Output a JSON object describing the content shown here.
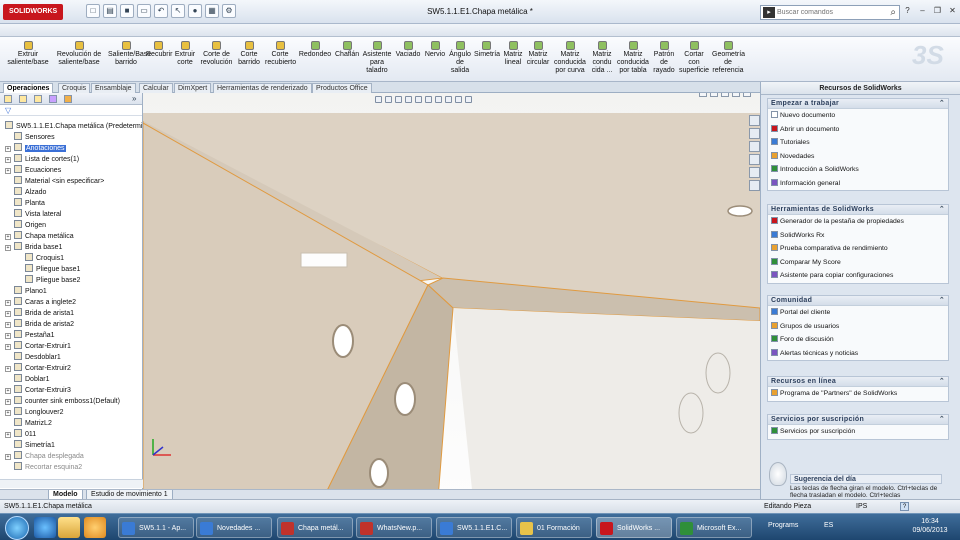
{
  "app": {
    "logo": "SOLIDWORKS",
    "document_title": "SW5.1.1.E1.Chapa metálica *"
  },
  "search": {
    "placeholder": "Buscar comandos"
  },
  "command_manager": {
    "buttons": [
      {
        "label": "Extruir saliente/base"
      },
      {
        "label": "Revolución de saliente/base"
      },
      {
        "label": "Saliente/Base barrido"
      },
      {
        "label": "Recubrir"
      },
      {
        "label": "Extruir corte"
      },
      {
        "label": "Corte de revolución"
      },
      {
        "label": "Corte barrido"
      },
      {
        "label": "Corte recubierto"
      },
      {
        "label": "Redondeo"
      },
      {
        "label": "Chaflán"
      },
      {
        "label": "Asistente para taladro"
      },
      {
        "label": "Vaciado"
      },
      {
        "label": "Nervio"
      },
      {
        "label": "Ángulo de salida"
      },
      {
        "label": "Simetría"
      },
      {
        "label": "Matriz lineal"
      },
      {
        "label": "Matriz circular"
      },
      {
        "label": "Matriz conducida por curva"
      },
      {
        "label": "Matriz condu cida ..."
      },
      {
        "label": "Matriz conducida por tabla"
      },
      {
        "label": "Patrón de rayado"
      },
      {
        "label": "Cortar con superficie"
      },
      {
        "label": "Geometría de referencia"
      }
    ]
  },
  "tabs": [
    {
      "label": "Operaciones",
      "active": true
    },
    {
      "label": "Croquis"
    },
    {
      "label": "Ensamblaje"
    },
    {
      "label": "Calcular"
    },
    {
      "label": "DimXpert"
    },
    {
      "label": "Herramientas de renderizado"
    },
    {
      "label": "Productos Office"
    }
  ],
  "feature_tree": {
    "root": "SW5.1.1.E1.Chapa metálica  (Predetermi",
    "items": [
      {
        "label": "Sensores",
        "level": 1,
        "expand": false
      },
      {
        "label": "Anotaciones",
        "level": 1,
        "expand": true,
        "highlighted": true
      },
      {
        "label": "Lista de cortes(1)",
        "level": 1,
        "expand": true
      },
      {
        "label": "Ecuaciones",
        "level": 1,
        "expand": true
      },
      {
        "label": "Material <sin especificar>",
        "level": 1,
        "expand": false
      },
      {
        "label": "Alzado",
        "level": 1,
        "expand": false
      },
      {
        "label": "Planta",
        "level": 1,
        "expand": false
      },
      {
        "label": "Vista lateral",
        "level": 1,
        "expand": false
      },
      {
        "label": "Origen",
        "level": 1,
        "expand": false
      },
      {
        "label": "Chapa metálica",
        "level": 1,
        "expand": true
      },
      {
        "label": "Brida base1",
        "level": 1,
        "expand": true
      },
      {
        "label": "Croquis1",
        "level": 2,
        "expand": false
      },
      {
        "label": "Pliegue base1",
        "level": 2,
        "expand": false
      },
      {
        "label": "Pliegue base2",
        "level": 2,
        "expand": false
      },
      {
        "label": "Plano1",
        "level": 1,
        "expand": false
      },
      {
        "label": "Caras a inglete2",
        "level": 1,
        "expand": true
      },
      {
        "label": "Brida de arista1",
        "level": 1,
        "expand": true
      },
      {
        "label": "Brida de arista2",
        "level": 1,
        "expand": true
      },
      {
        "label": "Pestaña1",
        "level": 1,
        "expand": true
      },
      {
        "label": "Cortar-Extruir1",
        "level": 1,
        "expand": true
      },
      {
        "label": "Desdoblar1",
        "level": 1,
        "expand": false
      },
      {
        "label": "Cortar-Extruir2",
        "level": 1,
        "expand": true
      },
      {
        "label": "Doblar1",
        "level": 1,
        "expand": false
      },
      {
        "label": "Cortar-Extruir3",
        "level": 1,
        "expand": true
      },
      {
        "label": "counter sink emboss1(Default)",
        "level": 1,
        "expand": true
      },
      {
        "label": "Longlouver2",
        "level": 1,
        "expand": true
      },
      {
        "label": "MatrizL2",
        "level": 1,
        "expand": false
      },
      {
        "label": "011",
        "level": 1,
        "expand": true
      },
      {
        "label": "Simetría1",
        "level": 1,
        "expand": false
      },
      {
        "label": "Chapa desplegada",
        "level": 1,
        "expand": true,
        "grayed": true
      },
      {
        "label": "Recortar esquina2",
        "level": 1,
        "expand": false,
        "grayed": true
      }
    ]
  },
  "bottom_tabs": [
    {
      "label": "Modelo",
      "active": true
    },
    {
      "label": "Estudio de movimiento 1"
    }
  ],
  "task_pane": {
    "title": "Recursos de SolidWorks",
    "sections": [
      {
        "title": "Empezar a trabajar",
        "items": [
          "Nuevo documento",
          "Abrir un documento",
          "Tutoriales",
          "Novedades",
          "Introducción a SolidWorks",
          "Información general"
        ]
      },
      {
        "title": "Herramientas de SolidWorks",
        "items": [
          "Generador de la pestaña de propiedades",
          "SolidWorks Rx",
          "Prueba comparativa de rendimiento",
          "Comparar My Score",
          "Asistente para copiar configuraciones"
        ]
      },
      {
        "title": "Comunidad",
        "items": [
          "Portal del cliente",
          "Grupos de usuarios",
          "Foro de discusión",
          "Alertas técnicas y noticias"
        ]
      },
      {
        "title": "Recursos en línea",
        "items": [
          "Programa de \"Partners\" de SolidWorks"
        ]
      },
      {
        "title": "Servicios por suscripción",
        "items": [
          "Servicios por suscripción"
        ]
      }
    ],
    "tip": {
      "title": "Sugerencia del día",
      "text": "Las teclas de flecha giran el modelo. Ctrl+teclas de flecha trasladan el modelo. Ctrl+teclas"
    }
  },
  "status_bar": {
    "left": "SW5.1.1.E1.Chapa metálica",
    "mode": "Editando Pieza",
    "units": "IPS",
    "help": "?"
  },
  "taskbar": {
    "items": [
      {
        "label": "SW5.1.1 - Ap...",
        "color": "#3a7bd5"
      },
      {
        "label": "Novedades ...",
        "color": "#3a7bd5"
      },
      {
        "label": "Chapa metál...",
        "color": "#c0322b"
      },
      {
        "label": "WhatsNew.p...",
        "color": "#c0322b"
      },
      {
        "label": "SW5.1.1.E1.C...",
        "color": "#3a7bd5"
      },
      {
        "label": "01 Formación",
        "color": "#e8c34a"
      },
      {
        "label": "SolidWorks ...",
        "color": "#c8161d",
        "active": true
      },
      {
        "label": "Microsoft Ex...",
        "color": "#2f8f3a"
      }
    ],
    "tray_programs": "Programs",
    "language": "ES",
    "time": "16:34",
    "date": "09/06/2013"
  },
  "colors": {
    "accent": "#c8161d",
    "selection": "#3a6fd6",
    "part_face": "#cfc2b0"
  }
}
